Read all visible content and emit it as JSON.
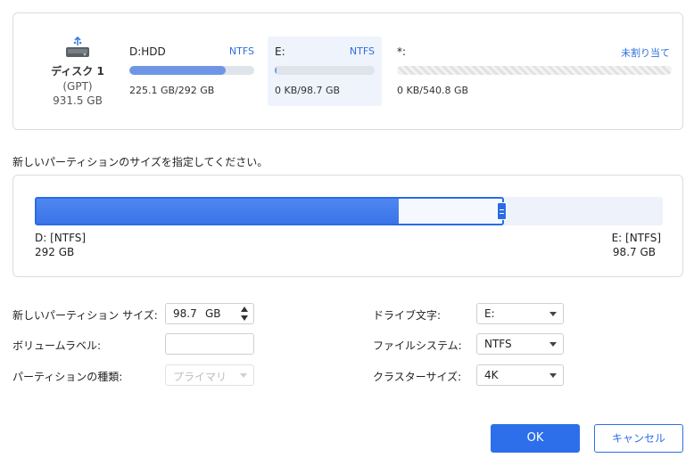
{
  "disk": {
    "icon": "usb-disk-icon",
    "name": "ディスク 1",
    "scheme": "(GPT)",
    "size": "931.5 GB"
  },
  "partitions": [
    {
      "name": "D:HDD",
      "fs": "NTFS",
      "usage": "225.1 GB/292 GB",
      "used_fraction": 0.77
    },
    {
      "name": "E:",
      "fs": "NTFS",
      "usage": "0 KB/98.7 GB",
      "used_fraction": 0.01
    },
    {
      "name": "*:",
      "fs": "未割り当て",
      "usage": "0 KB/540.8 GB"
    }
  ],
  "instruction": "新しいパーティションのサイズを指定してください。",
  "resize": {
    "left_name": "D: [NTFS]",
    "left_size": "292 GB",
    "right_name": "E: [NTFS]",
    "right_size": "98.7 GB"
  },
  "form": {
    "size_label": "新しいパーティション サイズ:",
    "size_value": "98.7",
    "size_unit": "GB",
    "volume_label": "ボリュームラベル:",
    "volume_value": "",
    "type_label": "パーティションの種類:",
    "type_value": "プライマリ",
    "drive_label": "ドライブ文字:",
    "drive_value": "E:",
    "fs_label": "ファイルシステム:",
    "fs_value": "NTFS",
    "cluster_label": "クラスターサイズ:",
    "cluster_value": "4K"
  },
  "buttons": {
    "ok": "OK",
    "cancel": "キャンセル"
  },
  "colors": {
    "accent": "#2d6fea",
    "bar_used": "#6f96e6",
    "selected_bg": "#eef3fc"
  }
}
